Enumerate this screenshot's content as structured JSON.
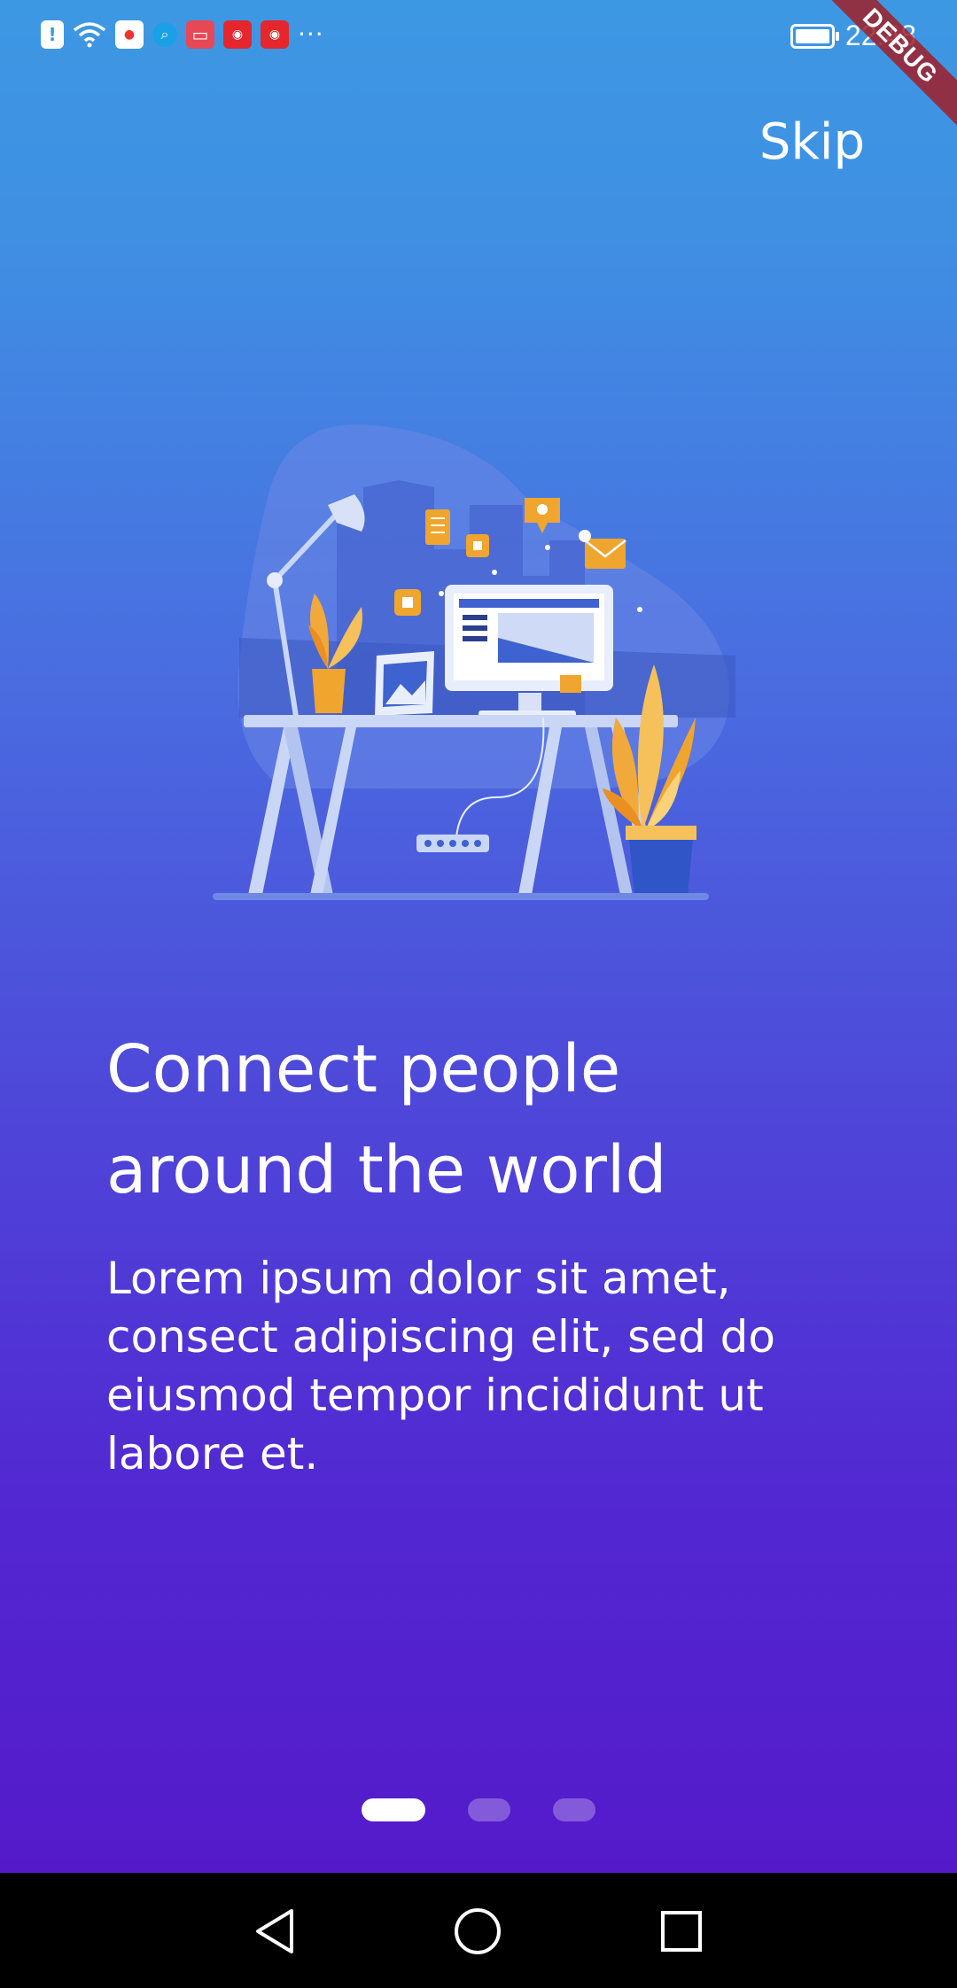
{
  "status_bar": {
    "time": "22:48",
    "icons": [
      "alert-icon",
      "wifi-icon",
      "app-icon",
      "search-app-icon",
      "book-app-icon",
      "weibo-icon",
      "weibo-icon",
      "more-notifications-icon"
    ],
    "more": "···"
  },
  "debug_banner": "DEBUG",
  "skip_label": "Skip",
  "headline": "Connect people around the world",
  "body": "Lorem ipsum dolor sit amet, consect adipiscing elit, sed do eiusmod tempor incididunt ut labore et.",
  "illustration": "desk-workspace-illustration",
  "page_indicator": {
    "pages": 3,
    "active_index": 0
  },
  "nav": {
    "back": "back-icon",
    "home": "home-icon",
    "recents": "recents-icon"
  },
  "colors": {
    "gradient_top": "#3d98e3",
    "gradient_bottom": "#5516c8",
    "text": "#ffffff",
    "nav_bar": "#000000"
  }
}
